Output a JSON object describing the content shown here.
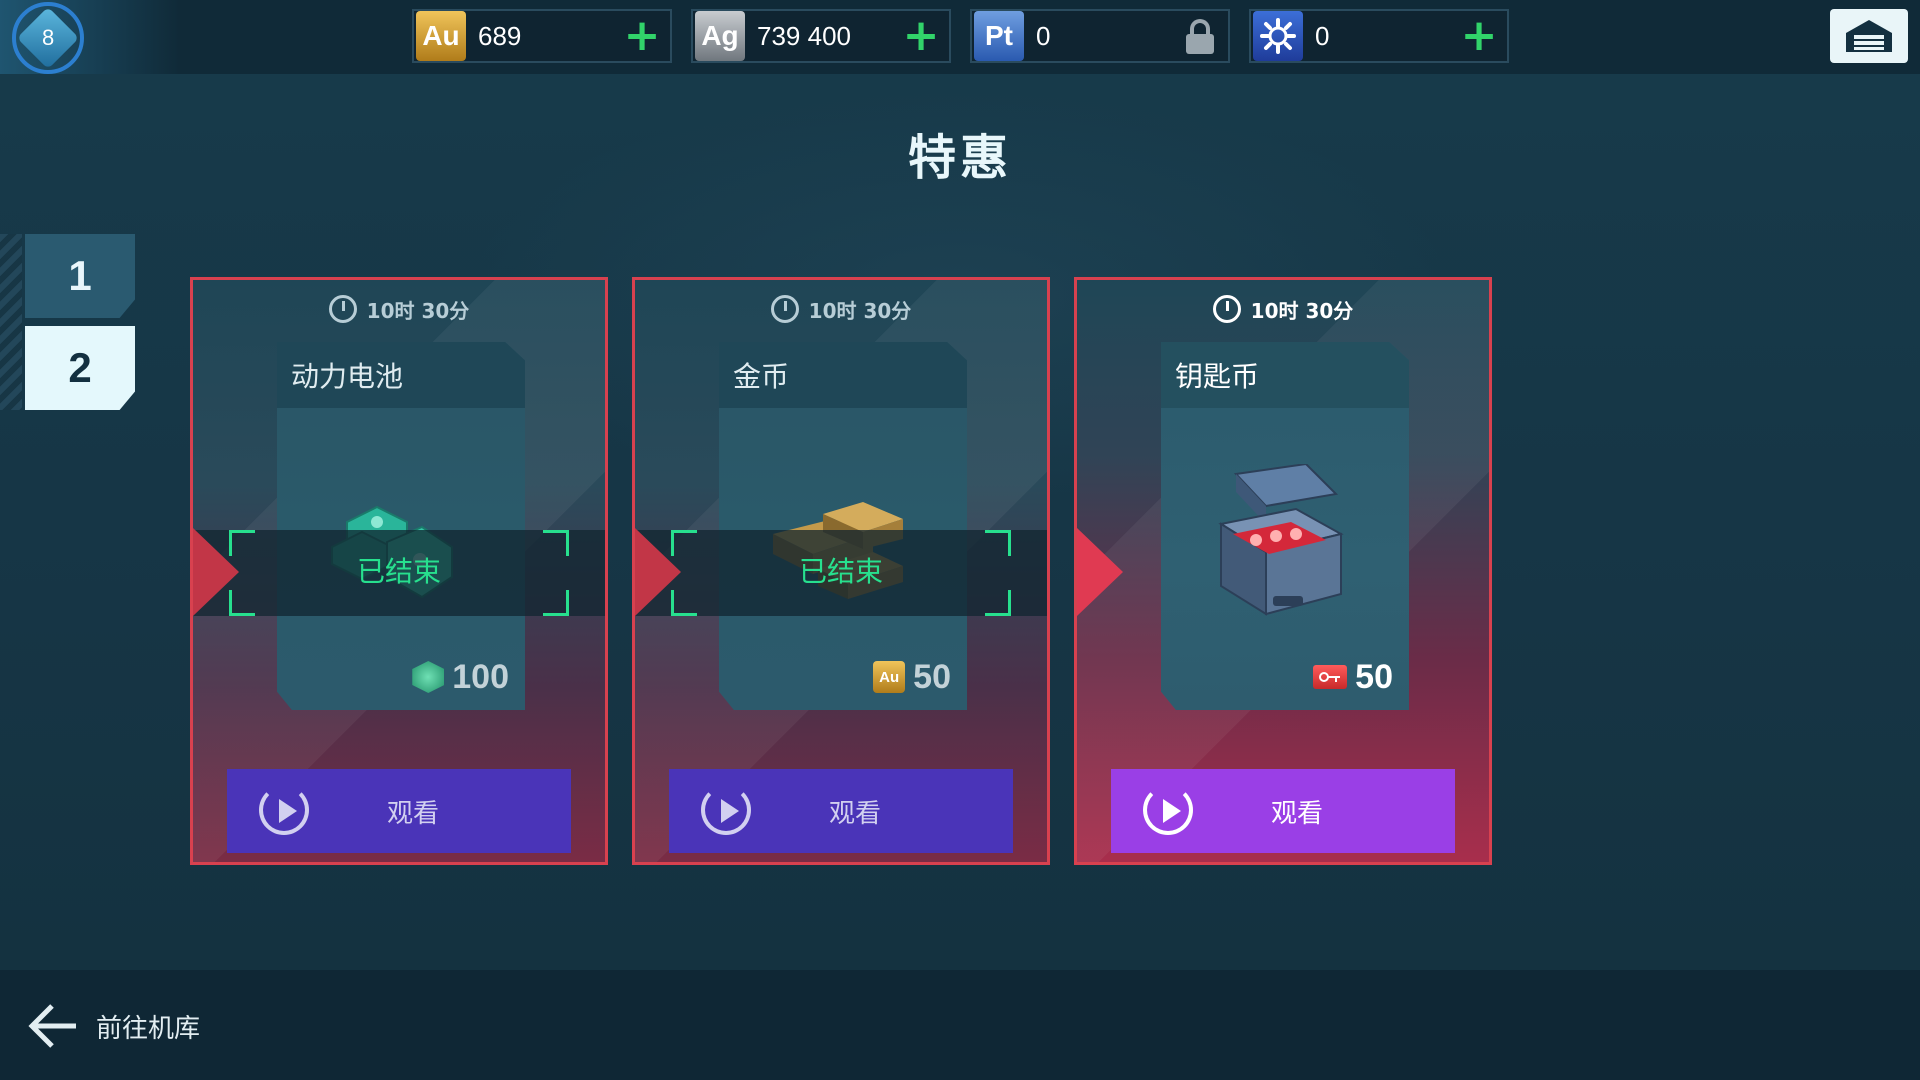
{
  "player": {
    "level": "8"
  },
  "currencies": [
    {
      "symbol": "Au",
      "value": "689",
      "action": "plus"
    },
    {
      "symbol": "Ag",
      "value": "739 400",
      "action": "plus"
    },
    {
      "symbol": "Pt",
      "value": "0",
      "action": "lock"
    },
    {
      "symbol": "gear",
      "value": "0",
      "action": "plus"
    }
  ],
  "page": {
    "title": "特惠"
  },
  "page_tabs": [
    {
      "label": "1",
      "selected": false
    },
    {
      "label": "2",
      "selected": true
    }
  ],
  "offers": [
    {
      "timer": "10时 30分",
      "name": "动力电池",
      "price": "100",
      "price_icon": "battery-gem-icon",
      "status": "已结束",
      "button": "观看"
    },
    {
      "timer": "10时 30分",
      "name": "金币",
      "price": "50",
      "price_icon_label": "Au",
      "status": "已结束",
      "button": "观看"
    },
    {
      "timer": "10时 30分",
      "name": "钥匙币",
      "price": "50",
      "price_icon": "key-icon",
      "button": "观看"
    }
  ],
  "footer": {
    "back_label": "前往机库"
  },
  "colors": {
    "accent_red": "#d8414f",
    "watch_active": "#9a3fe6",
    "watch_inactive": "#4a34b8",
    "ended_green": "#27e08e",
    "plus_green": "#31d36a"
  }
}
